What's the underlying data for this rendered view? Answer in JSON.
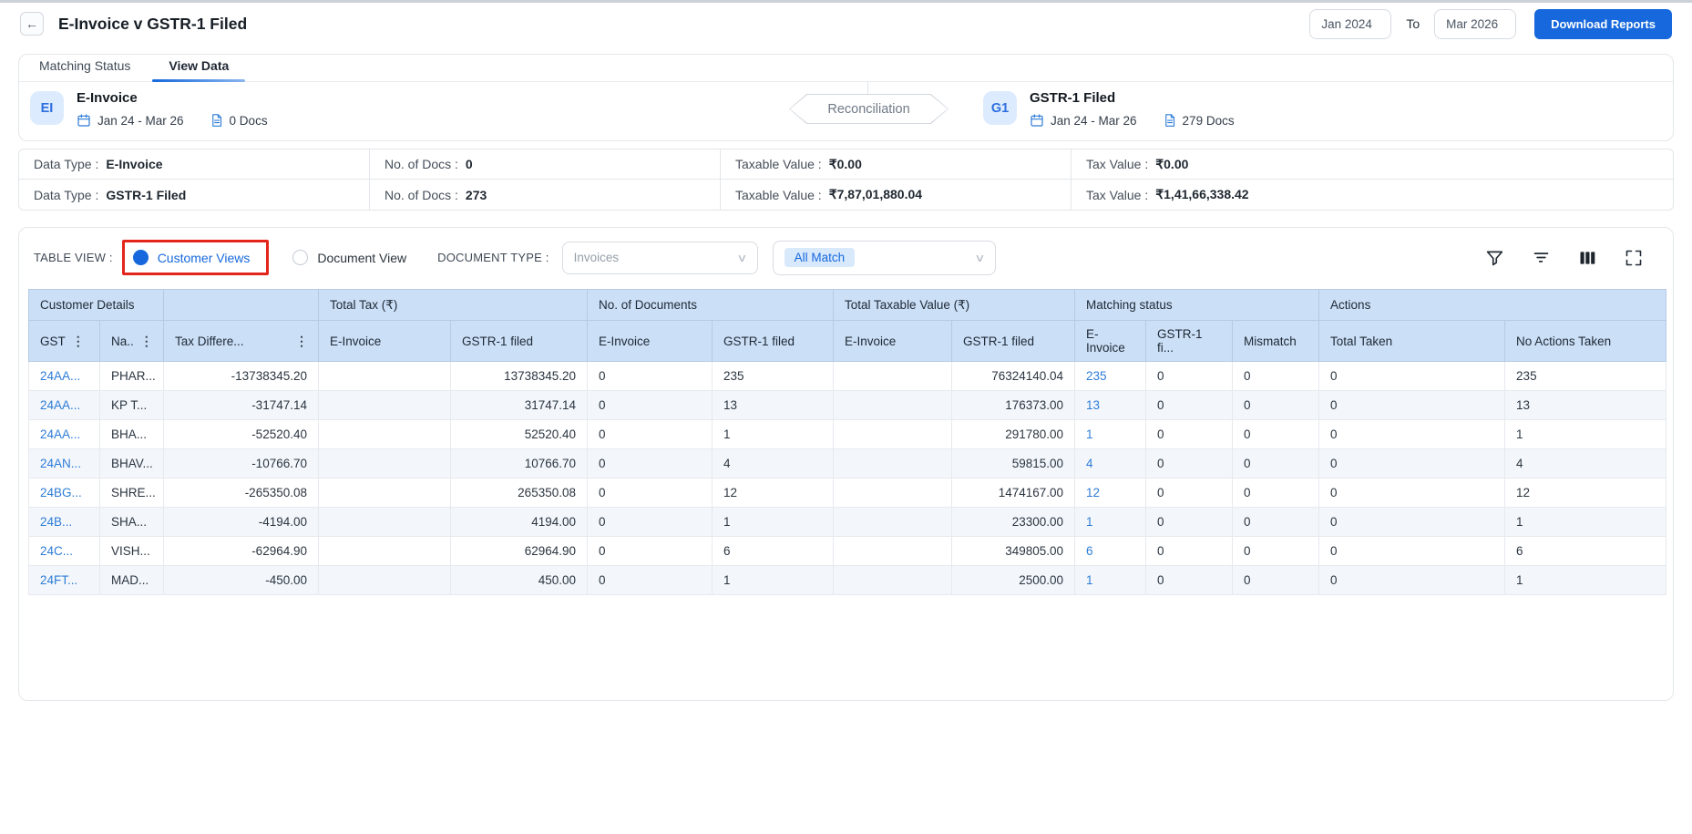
{
  "colors": {
    "accent": "#1668dc",
    "link": "#2e7cd6",
    "table_header_bg": "#cbdff6",
    "chip_bg": "#d9e9fc",
    "annotation_red": "#e4251c",
    "badge_bg": "#dcebfd"
  },
  "icons": {
    "back": "←",
    "kebab": "⋮",
    "chevron": "∨",
    "svg_names": [
      "calendar-icon",
      "document-icon",
      "funnel-icon",
      "filter-lines-icon",
      "column-view-icon",
      "fullscreen-icon"
    ]
  },
  "header": {
    "title": "E-Invoice v GSTR-1 Filed",
    "date_from": "Jan 2024",
    "to_label": "To",
    "date_to": "Mar 2026",
    "download_button": "Download Reports"
  },
  "tabs": [
    {
      "label": "Matching Status",
      "active": false
    },
    {
      "label": "View Data",
      "active": true
    }
  ],
  "sources": {
    "left": {
      "badge": "EI",
      "title": "E-Invoice",
      "date_range": "Jan 24 - Mar 26",
      "docs": "0 Docs"
    },
    "reconciliation_label": "Reconciliation",
    "right": {
      "badge": "G1",
      "title": "GSTR-1 Filed",
      "date_range": "Jan 24 - Mar 26",
      "docs": "279 Docs"
    }
  },
  "summary": {
    "rows": [
      {
        "data_type_label": "Data Type :",
        "data_type": "E-Invoice",
        "docs_label": "No. of Docs :",
        "docs": "0",
        "taxable_label": "Taxable Value :",
        "taxable": "₹0.00",
        "tax_label": "Tax Value :",
        "tax": "₹0.00"
      },
      {
        "data_type_label": "Data Type :",
        "data_type": "GSTR-1 Filed",
        "docs_label": "No. of Docs :",
        "docs": "273",
        "taxable_label": "Taxable Value :",
        "taxable": "₹7,87,01,880.04",
        "tax_label": "Tax Value :",
        "tax": "₹1,41,66,338.42"
      }
    ]
  },
  "controls": {
    "table_view_label": "TABLE VIEW :",
    "options": [
      {
        "label": "Customer Views",
        "selected": true,
        "highlighted": true
      },
      {
        "label": "Document View",
        "selected": false
      }
    ],
    "document_type_label": "DOCUMENT TYPE :",
    "document_type_value": "Invoices",
    "match_filter_value": "All Match"
  },
  "table": {
    "groups": [
      {
        "label": "Customer Details",
        "span": 2
      },
      {
        "label": "",
        "span": 1
      },
      {
        "label": "Total Tax (₹)",
        "span": 2
      },
      {
        "label": "No. of Documents",
        "span": 2
      },
      {
        "label": "Total Taxable Value (₹)",
        "span": 2
      },
      {
        "label": "Matching status",
        "span": 3
      },
      {
        "label": "Actions",
        "span": 2
      }
    ],
    "columns": [
      {
        "label": "GST",
        "menu": true
      },
      {
        "label": "Na..",
        "menu": true
      },
      {
        "label": "Tax Differe...",
        "menu": true
      },
      {
        "label": "E-Invoice"
      },
      {
        "label": "GSTR-1 filed"
      },
      {
        "label": "E-Invoice"
      },
      {
        "label": "GSTR-1 filed"
      },
      {
        "label": "E-Invoice"
      },
      {
        "label": "GSTR-1 filed"
      },
      {
        "label": "E-Invoice"
      },
      {
        "label": "GSTR-1 fi..."
      },
      {
        "label": "Mismatch"
      },
      {
        "label": "Total Taken"
      },
      {
        "label": "No Actions Taken"
      }
    ],
    "rows": [
      [
        "24AA...",
        "PHAR...",
        "-13738345.20",
        "",
        "13738345.20",
        "0",
        "235",
        "",
        "76324140.04",
        "235",
        "0",
        "0",
        "0",
        "235"
      ],
      [
        "24AA...",
        "KP T...",
        "-31747.14",
        "",
        "31747.14",
        "0",
        "13",
        "",
        "176373.00",
        "13",
        "0",
        "0",
        "0",
        "13"
      ],
      [
        "24AA...",
        "BHA...",
        "-52520.40",
        "",
        "52520.40",
        "0",
        "1",
        "",
        "291780.00",
        "1",
        "0",
        "0",
        "0",
        "1"
      ],
      [
        "24AN...",
        "BHAV...",
        "-10766.70",
        "",
        "10766.70",
        "0",
        "4",
        "",
        "59815.00",
        "4",
        "0",
        "0",
        "0",
        "4"
      ],
      [
        "24BG...",
        "SHRE...",
        "-265350.08",
        "",
        "265350.08",
        "0",
        "12",
        "",
        "1474167.00",
        "12",
        "0",
        "0",
        "0",
        "12"
      ],
      [
        "24B...",
        "SHA...",
        "-4194.00",
        "",
        "4194.00",
        "0",
        "1",
        "",
        "23300.00",
        "1",
        "0",
        "0",
        "0",
        "1"
      ],
      [
        "24C...",
        "VISH...",
        "-62964.90",
        "",
        "62964.90",
        "0",
        "6",
        "",
        "349805.00",
        "6",
        "0",
        "0",
        "0",
        "6"
      ],
      [
        "24FT...",
        "MAD...",
        "-450.00",
        "",
        "450.00",
        "0",
        "1",
        "",
        "2500.00",
        "1",
        "0",
        "0",
        "0",
        "1"
      ]
    ]
  }
}
